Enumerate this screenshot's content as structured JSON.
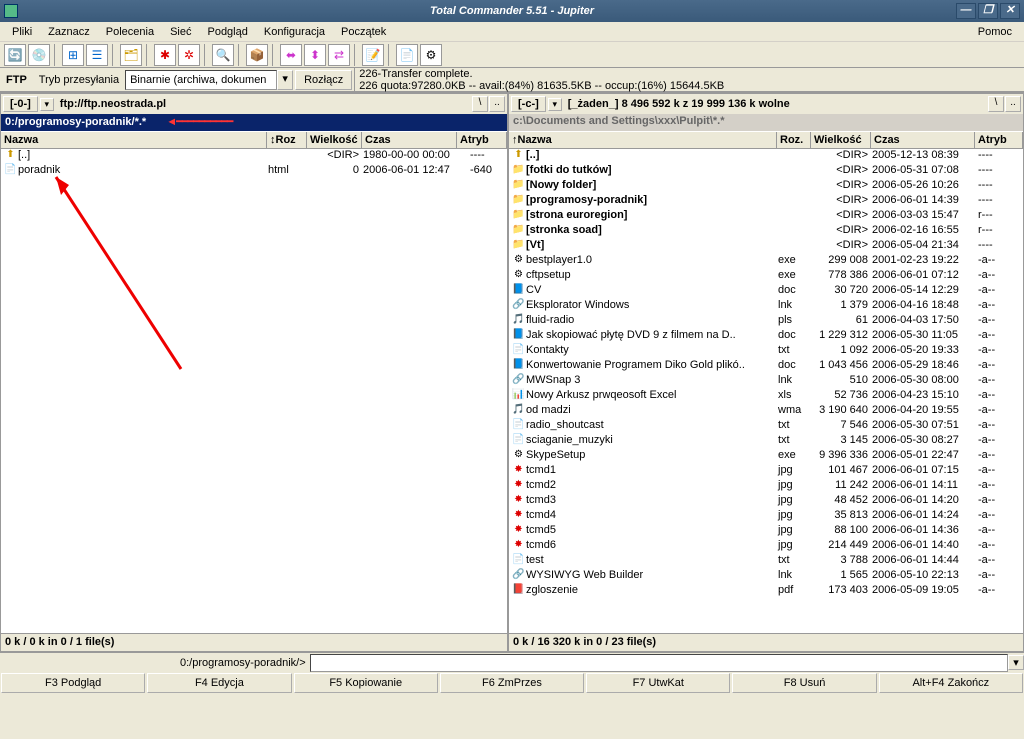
{
  "window": {
    "title": "Total Commander 5.51 - Jupiter"
  },
  "menu": {
    "items": [
      "Pliki",
      "Zaznacz",
      "Polecenia",
      "Sieć",
      "Podgląd",
      "Konfiguracja",
      "Początek"
    ],
    "help": "Pomoc"
  },
  "ftp": {
    "label": "FTP",
    "mode_label": "Tryb przesyłania",
    "mode_value": "Binarnie (archiwa, dokumen",
    "disconnect": "Rozłącz",
    "status1": "226-Transfer complete.",
    "status2": "226 quota:97280.0KB -- avail:(84%) 81635.5KB -- occup:(16%) 15644.5KB"
  },
  "left": {
    "drive": "[-0-]",
    "driveinfo": "ftp://ftp.neostrada.pl",
    "path": "0:/programosy-poradnik/*.*",
    "cols": {
      "name": "Nazwa",
      "ext": "↕Roz",
      "size": "Wielkość",
      "date": "Czas",
      "attr": "Atryb"
    },
    "rows": [
      {
        "icon": "up",
        "name": "[..]",
        "ext": "",
        "size": "<DIR>",
        "date": "1980-00-00 00:00",
        "attr": "----"
      },
      {
        "icon": "file",
        "name": "poradnik",
        "ext": "html",
        "size": "0",
        "date": "2006-06-01 12:47",
        "attr": "-640"
      }
    ],
    "sel": "0 k / 0 k in 0 / 1 file(s)"
  },
  "right": {
    "drive": "[-c-]",
    "driveinfo": "[_żaden_] 8 496 592 k z 19 999 136 k wolne",
    "path": "c:\\Documents and Settings\\xxx\\Pulpit\\*.*",
    "cols": {
      "name": "↑Nazwa",
      "ext": "Roz.",
      "size": "Wielkość",
      "date": "Czas",
      "attr": "Atryb"
    },
    "rows": [
      {
        "icon": "up",
        "name": "[..]",
        "ext": "",
        "size": "<DIR>",
        "date": "2005-12-13 08:39",
        "attr": "----"
      },
      {
        "icon": "fold",
        "name": "[fotki do tutków]",
        "ext": "",
        "size": "<DIR>",
        "date": "2006-05-31 07:08",
        "attr": "----"
      },
      {
        "icon": "fold",
        "name": "[Nowy folder]",
        "ext": "",
        "size": "<DIR>",
        "date": "2006-05-26 10:26",
        "attr": "----"
      },
      {
        "icon": "fold",
        "name": "[programosy-poradnik]",
        "ext": "",
        "size": "<DIR>",
        "date": "2006-06-01 14:39",
        "attr": "----"
      },
      {
        "icon": "foldr",
        "name": "[strona euroregion]",
        "ext": "",
        "size": "<DIR>",
        "date": "2006-03-03 15:47",
        "attr": "r---"
      },
      {
        "icon": "fold",
        "name": "[stronka soad]",
        "ext": "",
        "size": "<DIR>",
        "date": "2006-02-16 16:55",
        "attr": "r---"
      },
      {
        "icon": "fold",
        "name": "[Vt]",
        "ext": "",
        "size": "<DIR>",
        "date": "2006-05-04 21:34",
        "attr": "----"
      },
      {
        "icon": "exe",
        "name": "bestplayer1.0",
        "ext": "exe",
        "size": "299 008",
        "date": "2001-02-23 19:22",
        "attr": "-a--"
      },
      {
        "icon": "exe",
        "name": "cftpsetup",
        "ext": "exe",
        "size": "778 386",
        "date": "2006-06-01 07:12",
        "attr": "-a--"
      },
      {
        "icon": "doc",
        "name": "CV",
        "ext": "doc",
        "size": "30 720",
        "date": "2006-05-14 12:29",
        "attr": "-a--"
      },
      {
        "icon": "lnk",
        "name": "Eksplorator Windows",
        "ext": "lnk",
        "size": "1 379",
        "date": "2006-04-16 18:48",
        "attr": "-a--"
      },
      {
        "icon": "pls",
        "name": "fluid-radio",
        "ext": "pls",
        "size": "61",
        "date": "2006-04-03 17:50",
        "attr": "-a--"
      },
      {
        "icon": "doc",
        "name": "Jak skopiować płytę DVD 9 z filmem na D..",
        "ext": "doc",
        "size": "1 229 312",
        "date": "2006-05-30 11:05",
        "attr": "-a--"
      },
      {
        "icon": "txt",
        "name": "Kontakty",
        "ext": "txt",
        "size": "1 092",
        "date": "2006-05-20 19:33",
        "attr": "-a--"
      },
      {
        "icon": "doc",
        "name": "Konwertowanie Programem Diko Gold plikó..",
        "ext": "doc",
        "size": "1 043 456",
        "date": "2006-05-29 18:46",
        "attr": "-a--"
      },
      {
        "icon": "lnk",
        "name": "MWSnap 3",
        "ext": "lnk",
        "size": "510",
        "date": "2006-05-30 08:00",
        "attr": "-a--"
      },
      {
        "icon": "xls",
        "name": "Nowy Arkusz prwqeosoft Excel",
        "ext": "xls",
        "size": "52 736",
        "date": "2006-04-23 15:10",
        "attr": "-a--"
      },
      {
        "icon": "wma",
        "name": "od madzi",
        "ext": "wma",
        "size": "3 190 640",
        "date": "2006-04-20 19:55",
        "attr": "-a--"
      },
      {
        "icon": "txt",
        "name": "radio_shoutcast",
        "ext": "txt",
        "size": "7 546",
        "date": "2006-05-30 07:51",
        "attr": "-a--"
      },
      {
        "icon": "txt",
        "name": "sciaganie_muzyki",
        "ext": "txt",
        "size": "3 145",
        "date": "2006-05-30 08:27",
        "attr": "-a--"
      },
      {
        "icon": "exe",
        "name": "SkypeSetup",
        "ext": "exe",
        "size": "9 396 336",
        "date": "2006-05-01 22:47",
        "attr": "-a--"
      },
      {
        "icon": "jpg",
        "name": "tcmd1",
        "ext": "jpg",
        "size": "101 467",
        "date": "2006-06-01 07:15",
        "attr": "-a--"
      },
      {
        "icon": "jpg",
        "name": "tcmd2",
        "ext": "jpg",
        "size": "11 242",
        "date": "2006-06-01 14:11",
        "attr": "-a--"
      },
      {
        "icon": "jpg",
        "name": "tcmd3",
        "ext": "jpg",
        "size": "48 452",
        "date": "2006-06-01 14:20",
        "attr": "-a--"
      },
      {
        "icon": "jpg",
        "name": "tcmd4",
        "ext": "jpg",
        "size": "35 813",
        "date": "2006-06-01 14:24",
        "attr": "-a--"
      },
      {
        "icon": "jpg",
        "name": "tcmd5",
        "ext": "jpg",
        "size": "88 100",
        "date": "2006-06-01 14:36",
        "attr": "-a--"
      },
      {
        "icon": "jpg",
        "name": "tcmd6",
        "ext": "jpg",
        "size": "214 449",
        "date": "2006-06-01 14:40",
        "attr": "-a--"
      },
      {
        "icon": "txt",
        "name": "test",
        "ext": "txt",
        "size": "3 788",
        "date": "2006-06-01 14:44",
        "attr": "-a--"
      },
      {
        "icon": "lnk",
        "name": "WYSIWYG Web Builder",
        "ext": "lnk",
        "size": "1 565",
        "date": "2006-05-10 22:13",
        "attr": "-a--"
      },
      {
        "icon": "pdf",
        "name": "zgloszenie",
        "ext": "pdf",
        "size": "173 403",
        "date": "2006-05-09 19:05",
        "attr": "-a--"
      }
    ],
    "sel": "0 k / 16 320 k in 0 / 23 file(s)"
  },
  "cmdline": {
    "path": "0:/programosy-poradnik/>"
  },
  "fkeys": [
    "F3 Podgląd",
    "F4 Edycja",
    "F5 Kopiowanie",
    "F6 ZmPrzes",
    "F7 UtwKat",
    "F8 Usuń",
    "Alt+F4 Zakończ"
  ]
}
